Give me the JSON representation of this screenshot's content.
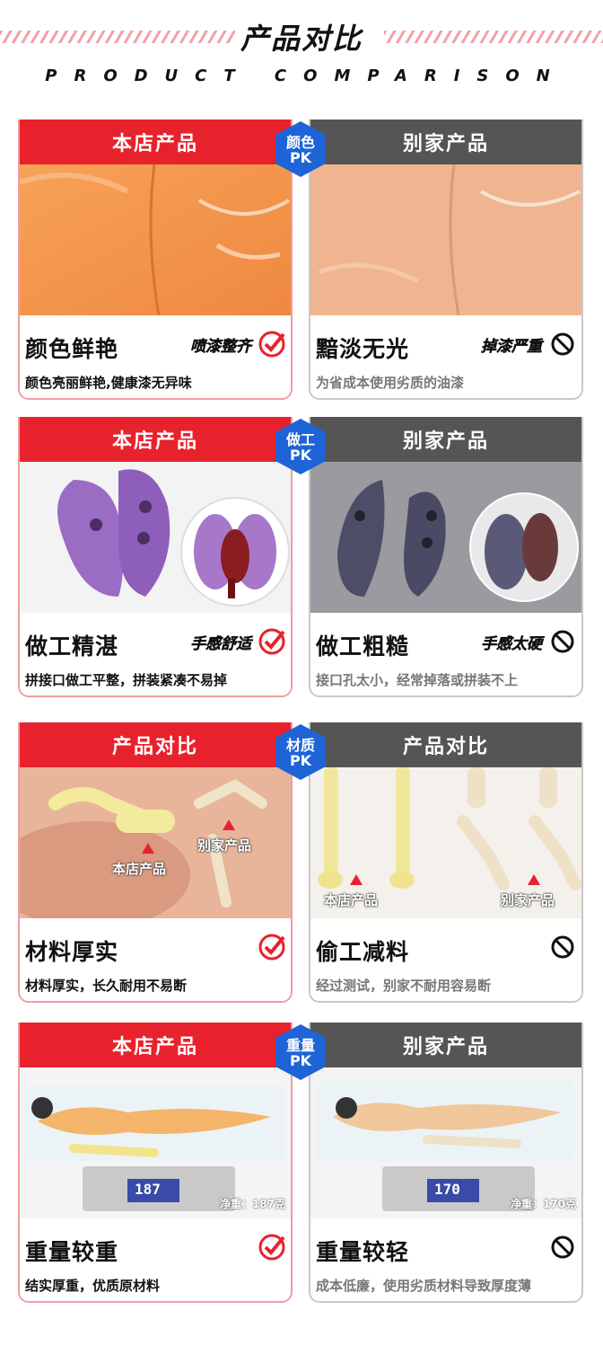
{
  "header": {
    "title": "产品对比",
    "subtitle": "PRODUCT COMPARISON"
  },
  "sections": [
    {
      "pk": {
        "line1": "颜色",
        "line2": "PK"
      },
      "ours": {
        "head": "本店产品",
        "feature": "颜色鲜艳",
        "tag": "喷漆整齐",
        "desc": "颜色亮丽鲜艳,健康漆无异味"
      },
      "theirs": {
        "head": "别家产品",
        "feature": "黯淡无光",
        "tag": "掉漆严重",
        "desc": "为省成本使用劣质的油漆"
      }
    },
    {
      "pk": {
        "line1": "做工",
        "line2": "PK"
      },
      "ours": {
        "head": "本店产品",
        "feature": "做工精湛",
        "tag": "手感舒适",
        "desc": "拼接口做工平整，拼装紧凑不易掉"
      },
      "theirs": {
        "head": "别家产品",
        "feature": "做工粗糙",
        "tag": "手感太硬",
        "desc": "接口孔太小，经常掉落或拼装不上"
      }
    },
    {
      "pk": {
        "line1": "材质",
        "line2": "PK"
      },
      "ours": {
        "head": "产品对比",
        "feature": "材料厚实",
        "tag": "",
        "desc": "材料厚实，长久耐用不易断",
        "label_a": "本店产品",
        "label_b": "别家产品"
      },
      "theirs": {
        "head": "产品对比",
        "feature": "偷工减料",
        "tag": "",
        "desc": "经过测试，别家不耐用容易断",
        "label_a": "本店产品",
        "label_b": "别家产品"
      }
    },
    {
      "pk": {
        "line1": "重量",
        "line2": "PK"
      },
      "ours": {
        "head": "本店产品",
        "feature": "重量较重",
        "tag": "",
        "desc": "结实厚重，优质原材料",
        "scale": "187",
        "weight": "净重：187克"
      },
      "theirs": {
        "head": "别家产品",
        "feature": "重量较轻",
        "tag": "",
        "desc": "成本低廉，使用劣质材料导致厚度薄",
        "scale": "170",
        "weight": "净重：170克"
      }
    }
  ],
  "colors": {
    "accent": "#e8222d",
    "dark": "#555555",
    "pk": "#1e64d6"
  }
}
